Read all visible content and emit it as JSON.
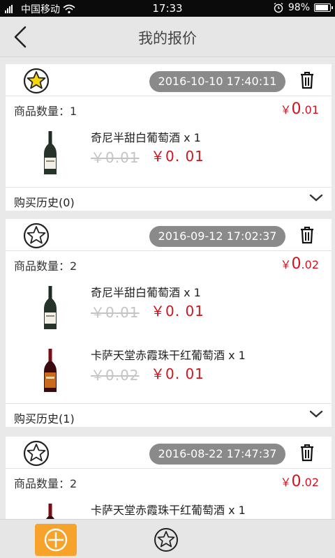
{
  "status_bar": {
    "carrier": "中国移动",
    "time": "17:33",
    "battery": "98%"
  },
  "nav": {
    "title": "我的报价"
  },
  "labels": {
    "qty_prefix": "商品数量：",
    "history_prefix": "购买历史"
  },
  "quotes": [
    {
      "favorited": true,
      "datetime": "2016-10-10 17:40:11",
      "qty_value": "1",
      "total_symbol": "￥",
      "total_int": "0",
      "total_dec": ".01",
      "items": [
        {
          "name": "奇尼半甜白葡萄酒 x 1",
          "old_price": "￥0.01",
          "new_price": "￥0. 01",
          "bottle": "white-wine"
        }
      ],
      "history": "(0)"
    },
    {
      "favorited": false,
      "datetime": "2016-09-12 17:02:37",
      "qty_value": "2",
      "total_symbol": "￥",
      "total_int": "0",
      "total_dec": ".02",
      "items": [
        {
          "name": "奇尼半甜白葡萄酒 x 1",
          "old_price": "￥0.01",
          "new_price": "￥0. 01",
          "bottle": "white-wine"
        },
        {
          "name": "卡萨天堂赤霞珠干红葡萄酒 x 1",
          "old_price": "￥0.02",
          "new_price": "￥0. 01",
          "bottle": "red-wine"
        }
      ],
      "history": "(1)"
    },
    {
      "favorited": false,
      "datetime": "2016-08-22 17:47:37",
      "qty_value": "2",
      "total_symbol": "￥",
      "total_int": "0",
      "total_dec": ".02",
      "items": [
        {
          "name": "卡萨天堂赤霞珠干红葡萄酒 x 1",
          "old_price": "",
          "new_price": "",
          "bottle": "red-wine"
        }
      ],
      "history": ""
    }
  ],
  "colors": {
    "price_red": "#d0141e",
    "pill_gray": "#8a8a8a",
    "star_yellow": "#f6d60c",
    "tab_orange": "#f7a32b"
  }
}
